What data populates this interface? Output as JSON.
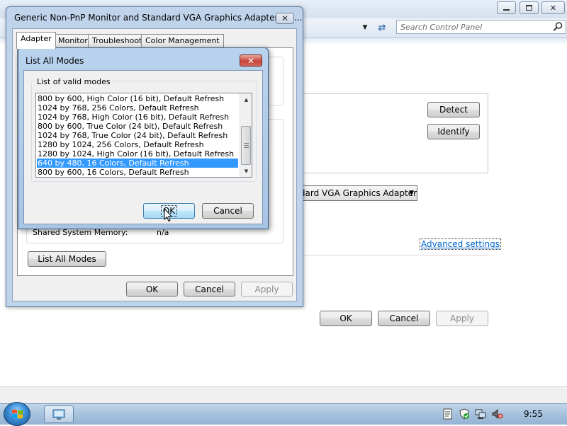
{
  "control_panel": {
    "search_placeholder": "Search Control Panel",
    "adapter_select_value": "Generic Non-PnP Monitor on Standard VGA Graphics Adapter",
    "detect_label": "Detect",
    "identify_label": "Identify",
    "advanced_settings_label": "Advanced settings",
    "ok_label": "OK",
    "cancel_label": "Cancel",
    "apply_label": "Apply"
  },
  "adapter_dialog": {
    "title": "Generic Non-PnP Monitor and Standard VGA Graphics Adapter Pro...",
    "close_glyph": "✕",
    "tabs": [
      {
        "label": "Adapter"
      },
      {
        "label": "Monitor"
      },
      {
        "label": "Troubleshoot"
      },
      {
        "label": "Color Management"
      }
    ],
    "shared_memory_label": "Shared System Memory:",
    "shared_memory_value": "n/a",
    "list_all_modes_label": "List All Modes",
    "ok_label": "OK",
    "cancel_label": "Cancel",
    "apply_label": "Apply"
  },
  "modes_dialog": {
    "title": "List All Modes",
    "close_glyph": "✕",
    "group_label": "List of valid modes",
    "modes": [
      {
        "text": "800 by 600, High Color (16 bit), Default Refresh"
      },
      {
        "text": "1024 by 768, 256 Colors, Default Refresh"
      },
      {
        "text": "1024 by 768, High Color (16 bit), Default Refresh"
      },
      {
        "text": "800 by 600, True Color (24 bit), Default Refresh"
      },
      {
        "text": "1024 by 768, True Color (24 bit), Default Refresh"
      },
      {
        "text": "1280 by 1024, 256 Colors, Default Refresh"
      },
      {
        "text": "1280 by 1024, High Color (16 bit), Default Refresh"
      },
      {
        "text": "640 by 480, 16 Colors, Default Refresh",
        "selected": true
      },
      {
        "text": "800 by 600, 16 Colors, Default Refresh"
      }
    ],
    "ok_label": "OK",
    "cancel_label": "Cancel"
  },
  "taskbar": {
    "clock": "9:55"
  },
  "colors": {
    "selection": "#3399ff",
    "link": "#0066cc",
    "close_red": "#c8453b"
  },
  "icons": [
    "search-icon",
    "refresh-icon",
    "windows-flag-icon",
    "display-properties-icon",
    "action-center-icon",
    "network-icon",
    "volume-muted-icon",
    "mouse-cursor-icon"
  ]
}
